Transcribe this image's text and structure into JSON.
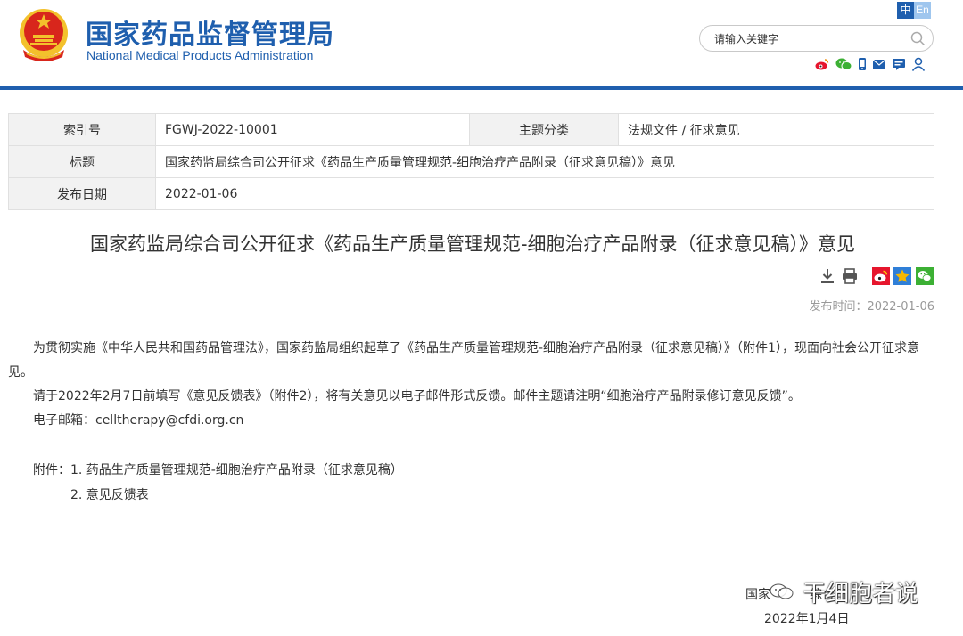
{
  "header": {
    "site_name_cn": "国家药品监督管理局",
    "site_name_en": "National Medical Products Administration",
    "lang_zh": "中",
    "lang_en": "En",
    "search_placeholder": "请输入关键字"
  },
  "colors": {
    "brand_blue": "#1f5fae",
    "weibo_red": "#e6162d",
    "wechat_green": "#3cb034",
    "qzone_yellow": "#f6b800"
  },
  "toolbar_icons": [
    "weibo-icon",
    "wechat-icon",
    "mobile-icon",
    "mail-icon",
    "message-board-icon",
    "user-icon"
  ],
  "info_table": {
    "index_label": "索引号",
    "index_value": "FGWJ-2022-10001",
    "category_label": "主题分类",
    "category_value": "法规文件 / 征求意见",
    "title_label": "标题",
    "title_value": "国家药监局综合司公开征求《药品生产质量管理规范-细胞治疗产品附录（征求意见稿）》意见",
    "date_label": "发布日期",
    "date_value": "2022-01-06"
  },
  "article": {
    "title": "国家药监局综合司公开征求《药品生产质量管理规范-细胞治疗产品附录（征求意见稿）》意见",
    "publish_time": "发布时间：2022-01-06",
    "para1": "为贯彻实施《中华人民共和国药品管理法》，国家药监局组织起草了《药品生产质量管理规范-细胞治疗产品附录（征求意见稿）》（附件1），现面向社会公开征求意见。",
    "para2": "请于2022年2月7日前填写《意见反馈表》（附件2），将有关意见以电子邮件形式反馈。邮件主题请注明“细胞治疗产品附录修订意见反馈”。",
    "email_line": "电子邮箱：celltherapy@cfdi.org.cn",
    "attachment_1": "附件：1. 药品生产质量管理规范-细胞治疗产品附录（征求意见稿）",
    "attachment_2": "2. 意见反馈表",
    "signature_org": "国家",
    "signature_org_tail": "综合司",
    "signature_date": "2022年1月4日"
  },
  "watermark_text": "干细胞者说"
}
